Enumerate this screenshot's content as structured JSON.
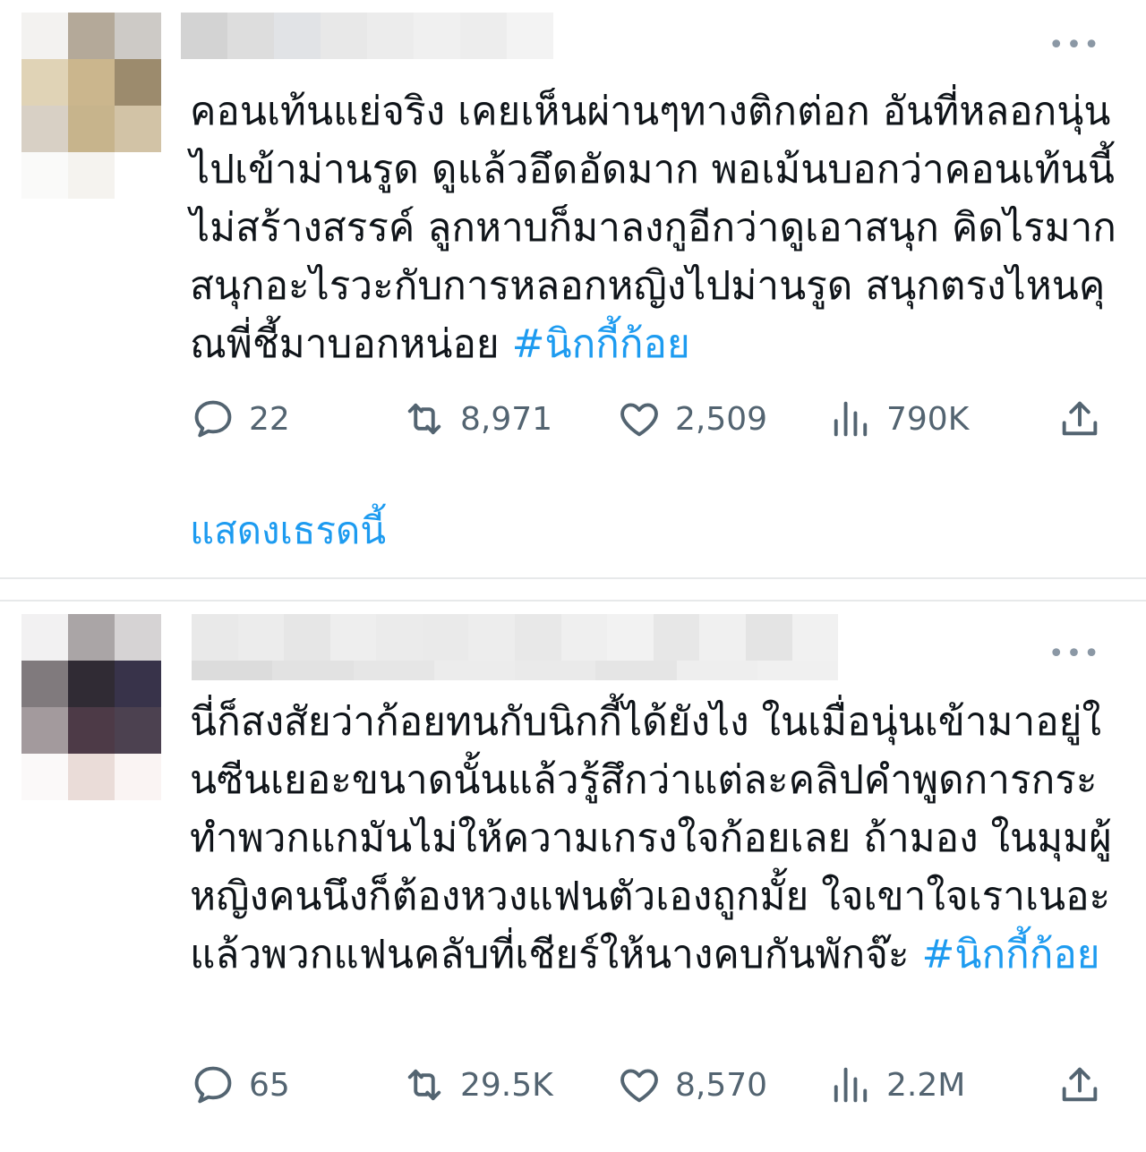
{
  "tweets": [
    {
      "more_label": "•••",
      "text": "คอนเท้นแย่จริง เคยเห็นผ่านๆทางติกต่อก อันที่หลอกนุ่นไปเข้าม่านรูด ดูแล้วอึดอัดมาก พอเม้นบอกว่าคอนเท้นนี้ไม่สร้างสรรค์ ลูกหาบก็มาลงกูอีกว่าดูเอาสนุก คิดไรมาก สนุกอะไรวะกับการหลอกหญิงไปม่านรูด สนุกตรงไหนคุณพี่ชี้มาบอกหน่อย ",
      "hashtag": "#นิกกี้ก้อย",
      "replies": "22",
      "retweets": "8,971",
      "likes": "2,509",
      "views": "790K",
      "show_thread": "แสดงเธรดนี้"
    },
    {
      "more_label": "•••",
      "text": "นี่ก็สงสัยว่าก้อยทนกับนิกกี้ได้ยังไง ในเมื่อนุ่นเข้ามาอยู่ในซีนเยอะขนาดนั้นแล้วรู้สึกว่าแต่ละคลิปคำพูดการกระทำพวกแกมันไม่ให้ความเกรงใจก้อยเลย ถ้ามอง ในมุมผู้หญิงคนนึงก็ต้องหวงแฟนตัวเองถูกมั้ย ใจเขาใจเราเนอะแล้วพวกแฟนคลับที่เชียร์ให้นางคบกันพักจ๊ะ ",
      "hashtag": "#นิกกี้ก้อย",
      "replies": "65",
      "retweets": "29.5K",
      "likes": "8,570",
      "views": "2.2M"
    }
  ],
  "colors": {
    "text": "#0f1419",
    "secondary": "#536471",
    "accent": "#1d9bf0",
    "separator": "#e7e9ea"
  },
  "icons": [
    "reply-icon",
    "retweet-icon",
    "like-icon",
    "views-icon",
    "share-icon",
    "more-icon"
  ]
}
